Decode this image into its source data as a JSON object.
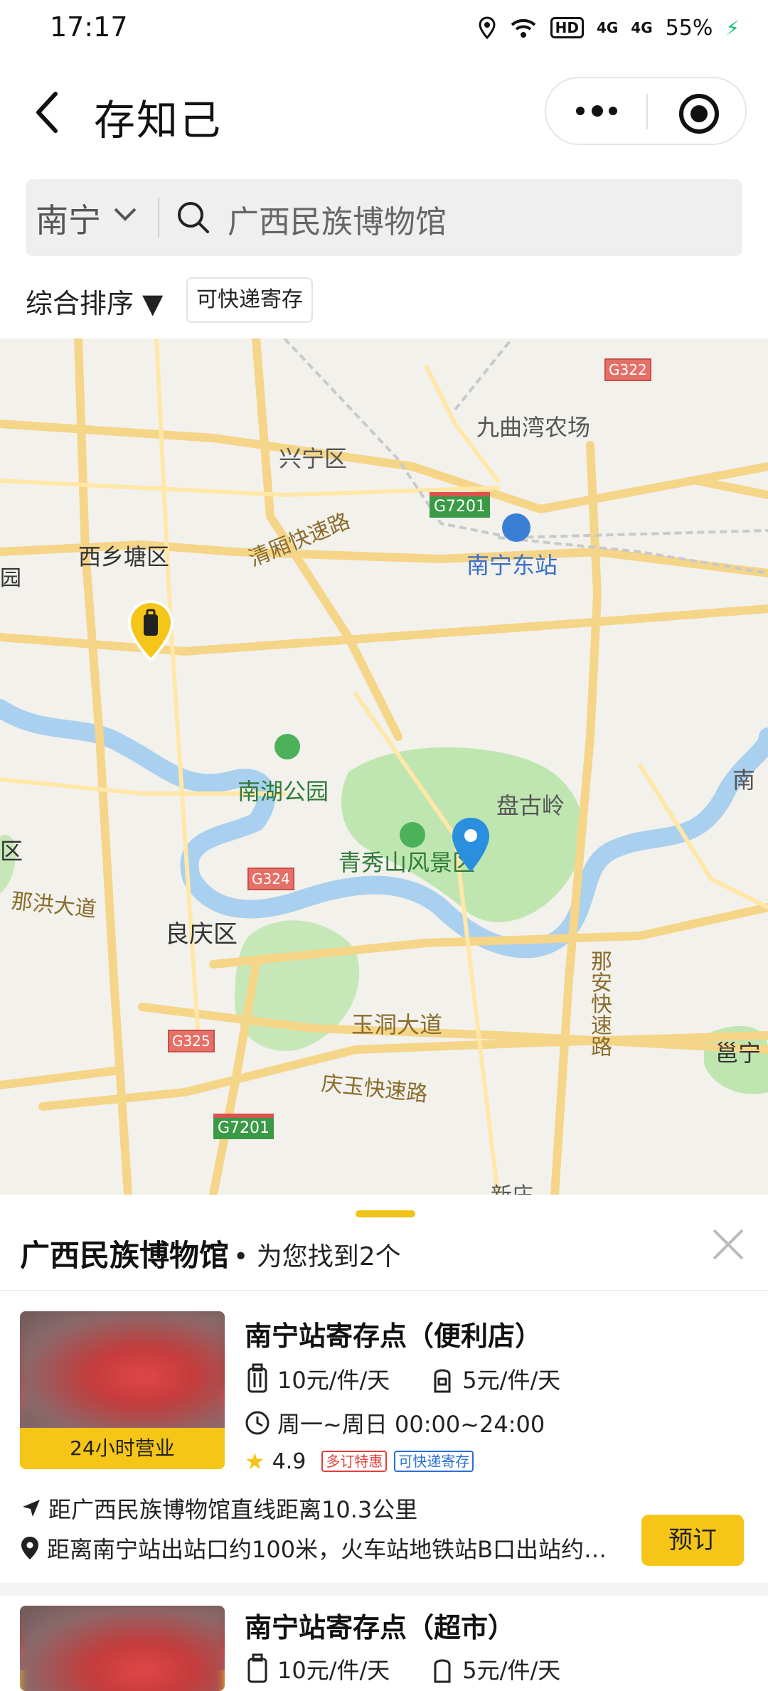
{
  "status": {
    "time": "17:17",
    "hd": "HD",
    "net1": "4G",
    "net2": "4G",
    "battery": "55%"
  },
  "app": {
    "title": "存知己"
  },
  "search": {
    "city": "南宁",
    "query": "广西民族博物馆"
  },
  "filters": {
    "sort": "综合排序 ▼",
    "tag": "可快递寄存"
  },
  "map": {
    "labels": {
      "xingning": "兴宁区",
      "jiuqu": "九曲湾农场",
      "g322": "G322",
      "g7201a": "G7201",
      "xixiang": "西乡塘区",
      "qingxiang": "清厢快速路",
      "nanning_east": "南宁东站",
      "yuan": "园",
      "nanhu": "南湖公园",
      "pangu": "盘古岭",
      "nan_r": "南",
      "qu_l": "区",
      "qingxiu": "青秀山风景区",
      "g324": "G324",
      "nahong": "那洪大道",
      "liangqing": "良庆区",
      "naan": "那安快速路",
      "yudong": "玉洞大道",
      "yong": "邕宁",
      "g325": "G325",
      "qingyu": "庆玉快速路",
      "g7201b": "G7201",
      "xinzhuang": "新庄"
    }
  },
  "results": {
    "title": "广西民族博物馆",
    "summary": "为您找到2个",
    "items": [
      {
        "name": "南宁站寄存点（便利店）",
        "badge": "24小时营业",
        "price_piece": "10元/件/天",
        "price_bag": "5元/件/天",
        "hours": "周一~周日 00:00~24:00",
        "rating": "4.9",
        "tag1": "多订特惠",
        "tag2": "可快递寄存",
        "distance": "距广西民族博物馆直线距离10.3公里",
        "address": "距离南宁站出站口约100米，火车站地铁站B口出站约…",
        "book": "预订"
      },
      {
        "name": "南宁站寄存点（超市）",
        "price_piece": "10元/件/天",
        "price_bag": "5元/件/天"
      }
    ]
  }
}
